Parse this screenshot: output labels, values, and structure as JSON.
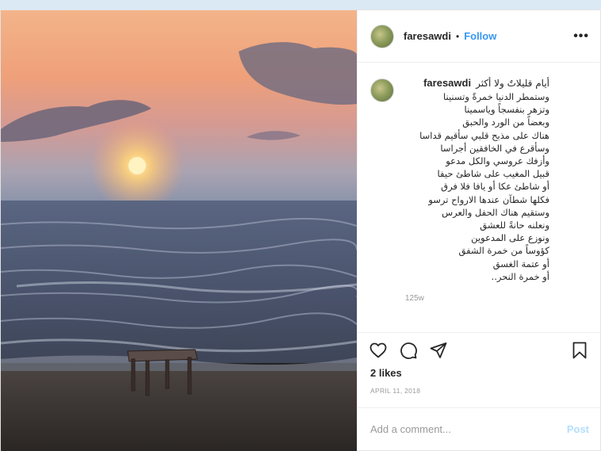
{
  "post": {
    "username": "faresawdi",
    "separator": "•",
    "follow_label": "Follow",
    "more_label": "•••",
    "caption": {
      "username": "faresawdi",
      "first_line": "أيام قليلاتٌ ولا أكثر",
      "lines": [
        "وستمطر الدنيا خمرةً وتسنينا",
        "وتزهر بنفسجاً وياسمينا",
        "وبعضاً من الورد والحبق",
        "هناك على مذبح قلبي سأقيم قداسا",
        "وسأقرع في الخافقين أجراسا",
        "وأزفك عروسي والكل مدعو",
        "قبيل المغيب على شاطئ حيفا",
        "أو شاطئ عكا أو يافا فلا فرق",
        "فكلها شطآن عندها الارواح ترسو",
        "وستقيم هناك الحفل والعرس",
        "ونعلنه حانةً للعشق",
        "ونوزع على المدعوين",
        "كؤوساً من خمرة الشفق",
        "أو عتمة الغسق",
        "أو خمرة النحر.."
      ],
      "time_ago": "125w"
    },
    "likes": "2 likes",
    "date": "APRIL 11, 2018",
    "comment_placeholder": "Add a comment...",
    "post_label": "Post",
    "icons": {
      "like": "heart-icon",
      "comment": "comment-icon",
      "share": "share-icon",
      "save": "bookmark-icon"
    },
    "colors": {
      "follow": "#3897f0",
      "post_disabled": "#b2dffc",
      "text": "#262626",
      "muted": "#999999"
    }
  }
}
